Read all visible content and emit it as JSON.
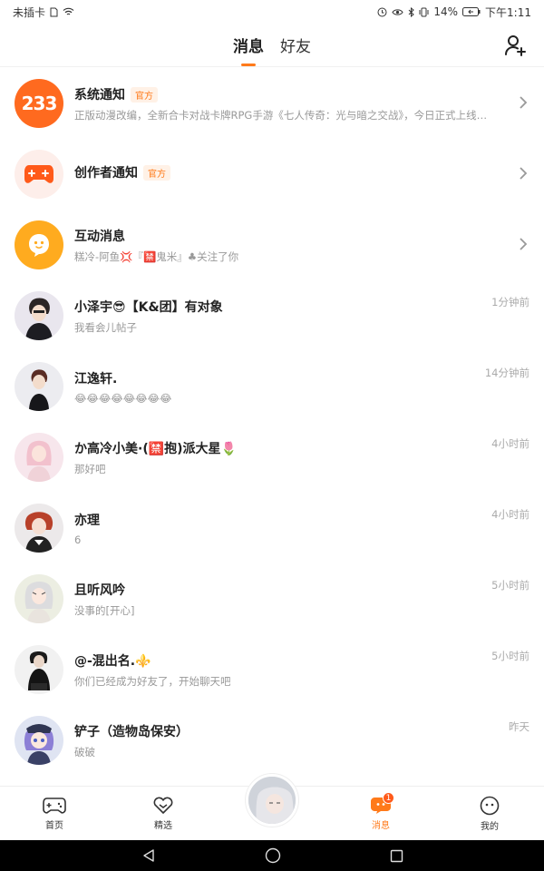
{
  "status_bar": {
    "carrier": "未插卡",
    "battery": "14%",
    "time": "下午1:11"
  },
  "header": {
    "tabs": [
      {
        "label": "消息",
        "active": true
      },
      {
        "label": "好友",
        "active": false
      }
    ],
    "add_friend_icon": "add-user-icon"
  },
  "conversations": [
    {
      "name": "系统通知",
      "official": "官方",
      "preview": "正版动漫改编，全新合卡对战卡牌RPG手游《七人传奇：光与暗之交战》，今日正式上线…",
      "time": "",
      "avatar_text": "233"
    },
    {
      "name": "创作者通知",
      "official": "官方",
      "preview": "",
      "time": ""
    },
    {
      "name": "互动消息",
      "official": "",
      "preview": "糕冷-阿鱼💢『🈲鬼米』♣关注了你",
      "time": ""
    },
    {
      "name": "小泽宇😎【K&团】有对象",
      "preview": "我看会儿帖子",
      "time": "1分钟前"
    },
    {
      "name": "江逸轩.",
      "preview": "😂😂😂😂😂😂😂😂",
      "time": "14分钟前"
    },
    {
      "name": "か高冷小美·(🈲抱)派大星🌷",
      "preview": "那好吧",
      "time": "4小时前"
    },
    {
      "name": "亦理",
      "preview": "6",
      "time": "4小时前"
    },
    {
      "name": "且听风吟",
      "preview": "没事的[开心]",
      "time": "5小时前"
    },
    {
      "name": "@-混出名.⚜️",
      "preview": "你们已经成为好友了，开始聊天吧",
      "time": "5小时前"
    },
    {
      "name": "铲子（造物岛保安）",
      "preview": "破破",
      "time": "昨天"
    }
  ],
  "bottom_nav": {
    "items": [
      {
        "label": "首页",
        "icon": "gamepad-icon"
      },
      {
        "label": "精选",
        "icon": "heart-badge-icon"
      },
      {
        "label": "消息",
        "icon": "message-icon",
        "badge": "1",
        "active": true
      },
      {
        "label": "我的",
        "icon": "smiley-icon"
      }
    ]
  },
  "colors": {
    "accent": "#ff7a1a",
    "official_bg": "#fff1e6"
  }
}
